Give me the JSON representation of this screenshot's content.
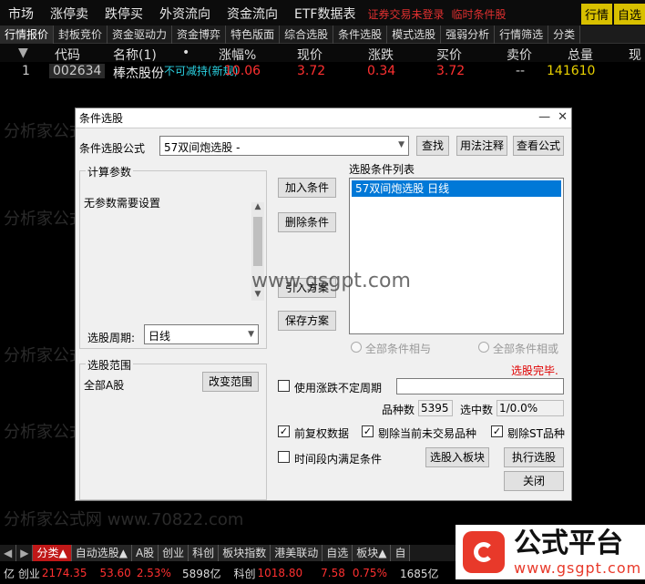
{
  "menubar": {
    "items": [
      "市场",
      "涨停卖",
      "跌停买",
      "外资流向",
      "资金流向",
      "ETF数据表"
    ],
    "highlight": [
      "证券交易未登录",
      "临时条件股"
    ],
    "right": [
      "行情",
      "自选"
    ]
  },
  "tabs": [
    "行情报价",
    "封板竞价",
    "资金驱动力",
    "资金博弈",
    "特色版面",
    "综合选股",
    "条件选股",
    "模式选股",
    "强弱分析",
    "行情筛选",
    "分类"
  ],
  "columns": [
    "代码",
    "名称(1)",
    "•",
    "涨幅%",
    "现价",
    "涨跌",
    "买价",
    "卖价",
    "总量",
    "现"
  ],
  "row": {
    "index": "1",
    "code": "002634",
    "name": "棒杰股份",
    "tag": "不可减持(新规)",
    "change_pct": "10.06",
    "price": "3.72",
    "change": "0.34",
    "bid": "3.72",
    "ask": "--",
    "volume": "141610"
  },
  "dialog": {
    "title": "条件选股",
    "formula_label": "条件选股公式",
    "formula_value": "57双间炮选股  -",
    "btn_find": "查找",
    "btn_usage": "用法注释",
    "btn_view": "查看公式",
    "params_title": "计算参数",
    "params_text": "无参数需要设置",
    "period_label": "选股周期:",
    "period_value": "日线",
    "btn_add": "加入条件",
    "btn_delete": "删除条件",
    "btn_import": "引入方案",
    "btn_save": "保存方案",
    "list_title": "选股条件列表",
    "list_items": [
      "57双间炮选股  日线"
    ],
    "radio_and": "全部条件相与",
    "radio_or": "全部条件相或",
    "status": "选股完毕.",
    "scope_title": "选股范围",
    "scope_value": "全部A股",
    "btn_change_scope": "改变范围",
    "use_period_label": "使用涨跌不定周期",
    "count_label": "品种数",
    "count_value": "5395",
    "hit_label": "选中数",
    "hit_value": "1/0.0%",
    "cb_fq": "前复权数据",
    "cb_exclude_today": "剔除当前未交易品种",
    "cb_exclude_st": "剔除ST品种",
    "cb_period": "时间段内满足条件",
    "btn_to_block": "选股入板块",
    "btn_execute": "执行选股",
    "btn_close": "关闭"
  },
  "watermarks": [
    "分析家公式网 www.70822.com",
    "www.gsgpt.com"
  ],
  "bottombar": [
    "分类▲",
    "自动选股▲",
    "A股",
    "创业",
    "科创",
    "板块指数",
    "港美联动",
    "自选",
    "板块▲",
    "自"
  ],
  "status": {
    "cy_label": "亿 创业",
    "cy_value": "2174.35",
    "cy_chg": "53.60",
    "cy_pct": "2.53%",
    "cy_amt": "5898亿",
    "kc_label": "科创",
    "kc_value": "1018.80",
    "kc_chg": "7.58",
    "kc_pct": "0.75%",
    "kc_amt": "1685亿"
  },
  "logo": {
    "text": "公式平台",
    "url": "www.gsgpt.com"
  }
}
